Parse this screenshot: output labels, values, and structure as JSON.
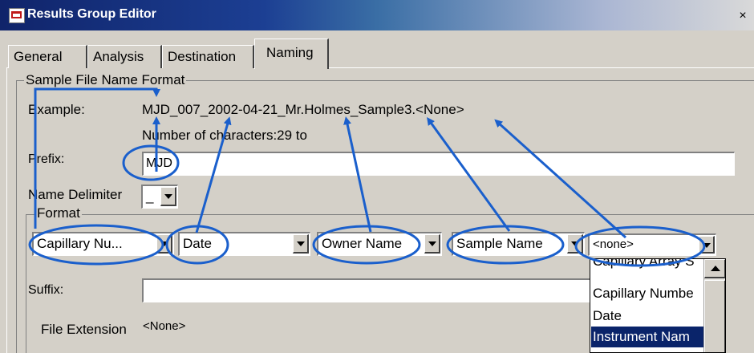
{
  "window": {
    "title": "Results Group Editor",
    "close_label": "×"
  },
  "tabs": [
    {
      "label": "General"
    },
    {
      "label": "Analysis"
    },
    {
      "label": "Destination"
    },
    {
      "label": "Naming"
    }
  ],
  "group": {
    "title": "Sample File Name Format",
    "example_label": "Example:",
    "example_value": "MJD_007_2002-04-21_Mr.Holmes_Sample3.<None>",
    "char_count": "Number of characters:29 to",
    "prefix_label": "Prefix:",
    "prefix_value": "MJD",
    "delimiter_label": "Name Delimiter",
    "delimiter_value": "_",
    "format_title": "Format",
    "format_fields": [
      "Capillary Nu...",
      "Date",
      "Owner Name",
      "Sample Name",
      "<none>"
    ],
    "suffix_label": "Suffix:",
    "suffix_value": "",
    "extension_label": "File Extension",
    "extension_value": "<None>"
  },
  "dropdown_list": {
    "items": [
      "Capillary Array S",
      "Capillary Numbe",
      "Date",
      "Instrument Nam"
    ],
    "selected": "Instrument Nam"
  },
  "colors": {
    "annotation": "#1a5fcc",
    "selection": "#0a246a",
    "titlebar": "#10246a"
  }
}
